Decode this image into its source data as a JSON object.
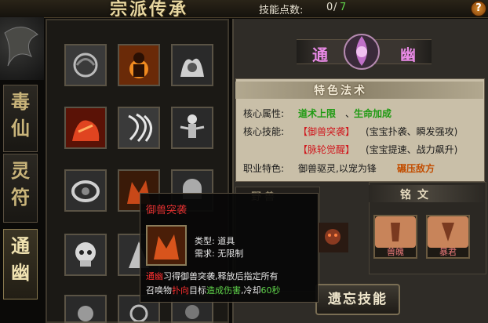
{
  "header": {
    "title": "宗派传承",
    "skill_points_label": "技能点数:",
    "skill_points_used": "0",
    "skill_points_slash": "/",
    "skill_points_max": "7",
    "help_label": "?"
  },
  "side_tabs": [
    {
      "label_1": "毒",
      "label_2": "仙"
    },
    {
      "label_1": "灵",
      "label_2": "符"
    },
    {
      "label_1": "通",
      "label_2": "幽"
    }
  ],
  "school": {
    "char_1": "通",
    "char_2": "幽"
  },
  "info": {
    "title": "特色法术",
    "core_attr_label": "核心属性:",
    "core_attr_1": "道术上限",
    "core_attr_sep": "、",
    "core_attr_2": "生命加成",
    "core_skill_label": "核心技能:",
    "skill_1": "【御兽突袭】",
    "skill_1_desc": "(宝宝扑袭、瞬发强攻)",
    "skill_2": "【脉轮觉醒】",
    "skill_2_desc": "(宝宝提速、战力飙升)",
    "feature_label": "职业特色:",
    "feature_text": "御兽驱灵,以宠为锋",
    "feature_highlight": "碾压敌方"
  },
  "beast_panel": {
    "title": "野兽"
  },
  "rune_panel": {
    "title": "铭文",
    "runes": [
      {
        "name": "兽魄"
      },
      {
        "name": "暴君"
      }
    ]
  },
  "forget_button": "遗忘技能",
  "tooltip": {
    "name": "御兽突袭",
    "type_label": "类型:",
    "type_value": "道具",
    "req_label": "需求:",
    "req_value": "无限制",
    "desc_school": "通幽",
    "desc_1": "习得御兽突袭,释放后指定所有",
    "desc_2a": "召唤物",
    "desc_2b": "扑向",
    "desc_2c": "目标",
    "desc_2d": "造成伤害",
    "desc_2e": ",冷却",
    "desc_2f": "60秒"
  },
  "colors": {
    "accent_purple": "#e98ae6",
    "green": "#1e9a12",
    "red": "#d0181e",
    "tooltip_red": "#ff3030"
  },
  "icons": [
    "swirl-skill-icon",
    "fire-palm-skill-icon",
    "flame-aura-skill-icon",
    "beast-rush-skill-icon",
    "claw-slash-skill-icon",
    "skeleton-summon-skill-icon",
    "bone-cage-skill-icon",
    "demon-fire-skill-icon",
    "ghost-skill-icon",
    "skull-skill-icon",
    "cloak-skill-icon",
    "spirit-skill-icon",
    "vortex-skill-icon",
    "orb-skill-icon",
    "mark-skill-icon"
  ]
}
